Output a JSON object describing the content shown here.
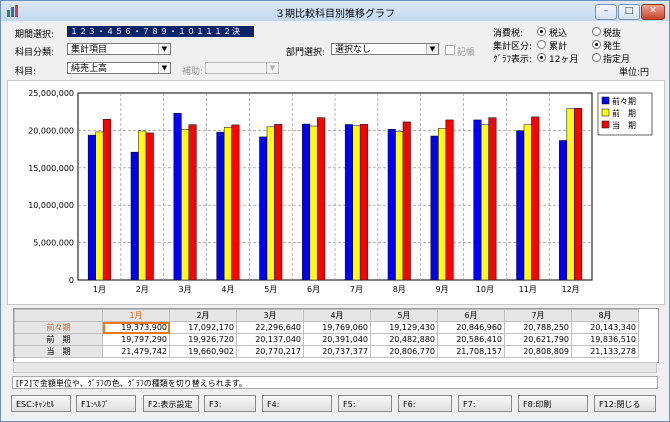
{
  "window": {
    "title": "３期比較科目別推移グラフ",
    "minimize": "–",
    "maximize": "□",
    "close": "✕"
  },
  "controls": {
    "period_label": "期間選択:",
    "period_value": "１２３・４５６・７８９・１０１１１２決",
    "account_class_label": "科目分類:",
    "account_class_value": "集計項目",
    "account_label": "科目:",
    "account_value": "純売上高",
    "sub_account_label": "補助:",
    "sub_account_value": "",
    "dept_label": "部門選択:",
    "dept_value": "選択なし",
    "dept_record_label": "記帳",
    "tax_label": "消費税:",
    "tax_options": [
      "税込",
      "税抜"
    ],
    "tax_selected": 0,
    "agg_label": "集計区分:",
    "agg_options": [
      "累計",
      "発生"
    ],
    "agg_selected": 1,
    "graph_label": "ｸﾞﾗﾌ表示:",
    "graph_options": [
      "12ヶ月",
      "指定月"
    ],
    "graph_selected": 0,
    "unit": "単位:円"
  },
  "chart_data": {
    "type": "bar",
    "categories": [
      "1月",
      "2月",
      "3月",
      "4月",
      "5月",
      "6月",
      "7月",
      "8月",
      "9月",
      "10月",
      "11月",
      "12月"
    ],
    "series": [
      {
        "name": "前々期",
        "color": "#0000ff",
        "values": [
          19373900,
          17092170,
          22296640,
          19769060,
          19129430,
          20846960,
          20788250,
          20143340,
          19250000,
          21400000,
          19950000,
          18650000
        ]
      },
      {
        "name": "前　期",
        "color": "#ffff00",
        "values": [
          19797290,
          19926720,
          20137040,
          20391040,
          20482880,
          20586410,
          20621790,
          19836510,
          20250000,
          20750000,
          20750000,
          22900000
        ]
      },
      {
        "name": "当　期",
        "color": "#ff0000",
        "values": [
          21479742,
          19660902,
          20770217,
          20737377,
          20806770,
          21708157,
          20808809,
          21133278,
          21400000,
          21700000,
          21800000,
          22950000
        ]
      }
    ],
    "yticks": [
      "25,000,000",
      "20,000,000",
      "15,000,000",
      "10,000,000",
      "5,000,000",
      "0"
    ],
    "ylim": [
      0,
      25000000
    ],
    "grid": true,
    "legend": "right"
  },
  "table": {
    "corner": "",
    "columns": [
      "1月",
      "2月",
      "3月",
      "4月",
      "5月",
      "6月",
      "7月",
      "8月"
    ],
    "rows": [
      {
        "label": "前々期",
        "values": [
          "19,373,900",
          "17,092,170",
          "22,296,640",
          "19,769,060",
          "19,129,430",
          "20,846,960",
          "20,788,250",
          "20,143,340"
        ]
      },
      {
        "label": "前　期",
        "values": [
          "19,797,290",
          "19,926,720",
          "20,137,040",
          "20,391,040",
          "20,482,880",
          "20,586,410",
          "20,621,790",
          "19,836,510"
        ]
      },
      {
        "label": "当　期",
        "values": [
          "21,479,742",
          "19,660,902",
          "20,770,217",
          "20,737,377",
          "20,806,770",
          "21,708,157",
          "20,808,809",
          "21,133,278"
        ]
      }
    ]
  },
  "status_text": "[F2]で金額単位や、ｸﾞﾗﾌの色、ｸﾞﾗﾌの種類を切り替えられます。",
  "fkeys": [
    "ESC:ｷｬﾝｾﾙ",
    "F1:ﾍﾙﾌﾟ",
    "F2:表示設定",
    "F3:",
    "F4:",
    "F5:",
    "F6:",
    "F7:",
    "F8:印刷",
    "F12:閉じる"
  ]
}
